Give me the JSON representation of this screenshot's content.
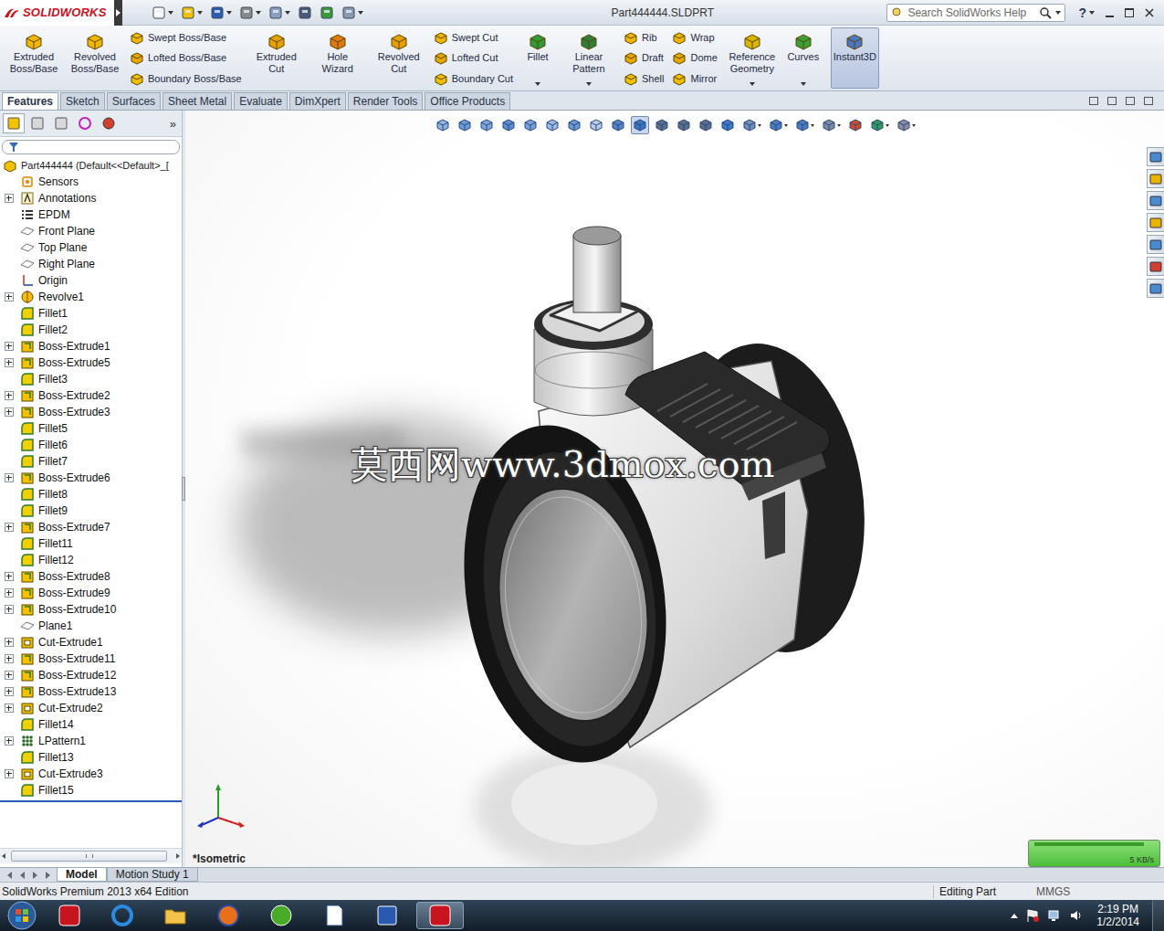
{
  "app": {
    "brand": "SOLIDWORKS",
    "title": "Part444444.SLDPRT",
    "search_placeholder": "Search SolidWorks Help",
    "help": "?"
  },
  "ribbon": [
    {
      "kind": "large",
      "label": "Extruded Boss/Base",
      "selected": false,
      "menu": false
    },
    {
      "kind": "large",
      "label": "Revolved Boss/Base",
      "selected": false,
      "menu": false
    },
    {
      "kind": "stack",
      "items": [
        {
          "label": "Swept Boss/Base"
        },
        {
          "label": "Lofted Boss/Base"
        },
        {
          "label": "Boundary Boss/Base"
        }
      ]
    },
    {
      "kind": "large",
      "label": "Extruded Cut",
      "selected": false,
      "menu": false
    },
    {
      "kind": "large",
      "label": "Hole Wizard",
      "selected": false,
      "menu": false
    },
    {
      "kind": "large",
      "label": "Revolved Cut",
      "selected": false,
      "menu": false
    },
    {
      "kind": "stack",
      "items": [
        {
          "label": "Swept Cut"
        },
        {
          "label": "Lofted Cut"
        },
        {
          "label": "Boundary Cut"
        }
      ]
    },
    {
      "kind": "large",
      "label": "Fillet",
      "selected": false,
      "menu": true
    },
    {
      "kind": "large",
      "label": "Linear Pattern",
      "selected": false,
      "menu": true
    },
    {
      "kind": "stack",
      "items": [
        {
          "label": "Rib"
        },
        {
          "label": "Draft"
        },
        {
          "label": "Shell"
        }
      ]
    },
    {
      "kind": "stack",
      "items": [
        {
          "label": "Wrap"
        },
        {
          "label": "Dome"
        },
        {
          "label": "Mirror"
        }
      ]
    },
    {
      "kind": "large",
      "label": "Reference Geometry",
      "selected": false,
      "menu": true
    },
    {
      "kind": "large",
      "label": "Curves",
      "selected": false,
      "menu": true
    },
    {
      "kind": "large",
      "label": "Instant3D",
      "selected": true,
      "menu": false
    }
  ],
  "tabs": [
    {
      "label": "Features",
      "selected": true
    },
    {
      "label": "Sketch",
      "selected": false
    },
    {
      "label": "Surfaces",
      "selected": false
    },
    {
      "label": "Sheet Metal",
      "selected": false
    },
    {
      "label": "Evaluate",
      "selected": false
    },
    {
      "label": "DimXpert",
      "selected": false
    },
    {
      "label": "Render Tools",
      "selected": false
    },
    {
      "label": "Office Products",
      "selected": false
    }
  ],
  "panel_tabs": {
    "tabs": [
      {
        "selected": true
      },
      {
        "selected": false
      },
      {
        "selected": false
      },
      {
        "selected": false
      },
      {
        "selected": false
      }
    ],
    "more": "»"
  },
  "tree": {
    "root": "Part444444 (Default<<Default>_[",
    "items": [
      {
        "label": "Sensors",
        "kind": "sensor",
        "expandable": false
      },
      {
        "label": "Annotations",
        "kind": "annotation",
        "expandable": true
      },
      {
        "label": "EPDM",
        "kind": "equation",
        "expandable": false
      },
      {
        "label": "Front Plane",
        "kind": "plane",
        "expandable": false
      },
      {
        "label": "Top Plane",
        "kind": "plane",
        "expandable": false
      },
      {
        "label": "Right Plane",
        "kind": "plane",
        "expandable": false
      },
      {
        "label": "Origin",
        "kind": "origin",
        "expandable": false
      },
      {
        "label": "Revolve1",
        "kind": "revolve",
        "expandable": true
      },
      {
        "label": "Fillet1",
        "kind": "fillet",
        "expandable": false
      },
      {
        "label": "Fillet2",
        "kind": "fillet",
        "expandable": false
      },
      {
        "label": "Boss-Extrude1",
        "kind": "extrude",
        "expandable": true
      },
      {
        "label": "Boss-Extrude5",
        "kind": "extrude",
        "expandable": true
      },
      {
        "label": "Fillet3",
        "kind": "fillet",
        "expandable": false
      },
      {
        "label": "Boss-Extrude2",
        "kind": "extrude",
        "expandable": true
      },
      {
        "label": "Boss-Extrude3",
        "kind": "extrude",
        "expandable": true
      },
      {
        "label": "Fillet5",
        "kind": "fillet",
        "expandable": false
      },
      {
        "label": "Fillet6",
        "kind": "fillet",
        "expandable": false
      },
      {
        "label": "Fillet7",
        "kind": "fillet",
        "expandable": false
      },
      {
        "label": "Boss-Extrude6",
        "kind": "extrude",
        "expandable": true
      },
      {
        "label": "Fillet8",
        "kind": "fillet",
        "expandable": false
      },
      {
        "label": "Fillet9",
        "kind": "fillet",
        "expandable": false
      },
      {
        "label": "Boss-Extrude7",
        "kind": "extrude",
        "expandable": true
      },
      {
        "label": "Fillet11",
        "kind": "fillet",
        "expandable": false
      },
      {
        "label": "Fillet12",
        "kind": "fillet",
        "expandable": false
      },
      {
        "label": "Boss-Extrude8",
        "kind": "extrude",
        "expandable": true
      },
      {
        "label": "Boss-Extrude9",
        "kind": "extrude",
        "expandable": true
      },
      {
        "label": "Boss-Extrude10",
        "kind": "extrude",
        "expandable": true
      },
      {
        "label": "Plane1",
        "kind": "plane",
        "expandable": false
      },
      {
        "label": "Cut-Extrude1",
        "kind": "cut",
        "expandable": true
      },
      {
        "label": "Boss-Extrude11",
        "kind": "extrude",
        "expandable": true
      },
      {
        "label": "Boss-Extrude12",
        "kind": "extrude",
        "expandable": true
      },
      {
        "label": "Boss-Extrude13",
        "kind": "extrude",
        "expandable": true
      },
      {
        "label": "Cut-Extrude2",
        "kind": "cut",
        "expandable": true
      },
      {
        "label": "Fillet14",
        "kind": "fillet",
        "expandable": false
      },
      {
        "label": "LPattern1",
        "kind": "pattern",
        "expandable": true
      },
      {
        "label": "Fillet13",
        "kind": "fillet",
        "expandable": false
      },
      {
        "label": "Cut-Extrude3",
        "kind": "cut",
        "expandable": true
      },
      {
        "label": "Fillet15",
        "kind": "fillet",
        "expandable": false
      }
    ]
  },
  "graphics": {
    "view_label": "*Isometric",
    "watermark": "莫西网www.3dmox.com",
    "view_toolbar": [
      {
        "selected": false,
        "menu": false
      },
      {
        "selected": false,
        "menu": false
      },
      {
        "selected": false,
        "menu": false
      },
      {
        "selected": false,
        "menu": false
      },
      {
        "selected": false,
        "menu": false
      },
      {
        "selected": false,
        "menu": false
      },
      {
        "selected": false,
        "menu": false
      },
      {
        "selected": false,
        "menu": false
      },
      {
        "selected": false,
        "menu": false
      },
      {
        "selected": true,
        "menu": false
      },
      {
        "selected": false,
        "menu": false
      },
      {
        "selected": false,
        "menu": false
      },
      {
        "selected": false,
        "menu": false
      },
      {
        "selected": false,
        "menu": false
      },
      {
        "selected": false,
        "menu": true
      },
      {
        "selected": false,
        "menu": true
      },
      {
        "selected": false,
        "menu": true
      },
      {
        "selected": false,
        "menu": true
      },
      {
        "selected": false,
        "menu": false
      },
      {
        "selected": false,
        "menu": true
      },
      {
        "selected": false,
        "menu": true
      }
    ]
  },
  "network_meter": {
    "reading": "5 KB/s"
  },
  "bottom_tabs": [
    {
      "label": "Model",
      "selected": true
    },
    {
      "label": "Motion Study 1",
      "selected": false
    }
  ],
  "status_bar": {
    "left": "SolidWorks Premium 2013 x64 Edition",
    "mode": "Editing Part",
    "units": "MMGS"
  },
  "taskbar": {
    "apps": [
      {
        "kind": "solidworks",
        "active": false
      },
      {
        "kind": "ie",
        "active": false
      },
      {
        "kind": "explorer",
        "active": false
      },
      {
        "kind": "firefox",
        "active": false
      },
      {
        "kind": "utorrent",
        "active": false
      },
      {
        "kind": "notepad",
        "active": false
      },
      {
        "kind": "word",
        "active": false
      },
      {
        "kind": "solidworks",
        "active": true
      }
    ],
    "time": "2:19 PM",
    "date": "1/2/2014"
  }
}
